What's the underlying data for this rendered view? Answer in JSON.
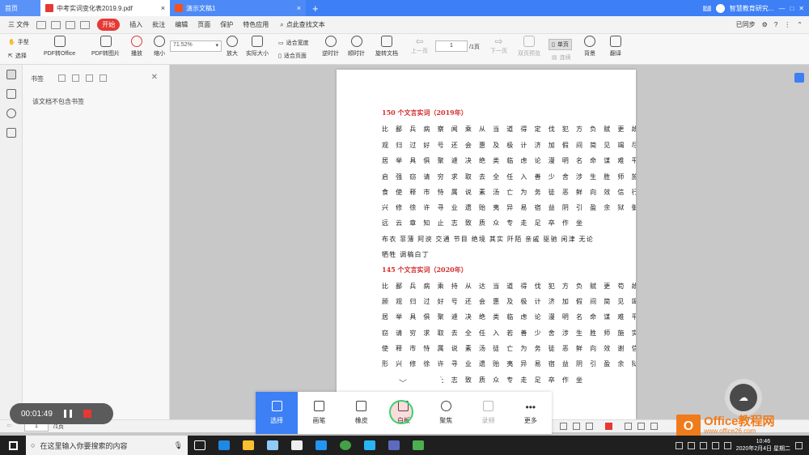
{
  "tabs": {
    "home": "首页",
    "active": "中考实词变化表2019.9.pdf",
    "other": "演示文稿1",
    "badge": "2",
    "account": "智慧教育研究..."
  },
  "menu": {
    "file": "三 文件",
    "items": [
      "开始",
      "插入",
      "批注",
      "编辑",
      "页面",
      "保护",
      "特色应用"
    ],
    "search": "点此查找文本",
    "sync": "已同步",
    "more": "?"
  },
  "ribbon": {
    "hand": "手型",
    "select": "选择",
    "pdf_to_office": "PDF转Office",
    "pdf_to_image": "PDF转图片",
    "play": "播放",
    "zoom_out": "缩小",
    "zoom_value": "71.52%",
    "zoom_in": "放大",
    "actual_size": "实际大小",
    "fit_width": "适合宽度",
    "fit_page": "适合页面",
    "rotate_ccw": "逆时针",
    "rotate_cw": "顺时针",
    "rotate_doc": "旋转文档",
    "prev": "上一页",
    "page_value": "1",
    "page_total": "/1页",
    "next": "下一页",
    "double": "双页预览",
    "single": "单页",
    "continuous": "连续",
    "background": "背景",
    "translate": "翻译"
  },
  "bookmark": {
    "title": "书签",
    "empty": "该文档不包含书签"
  },
  "document": {
    "heading1": "150 个文言实词（2019年）",
    "lines1": [
      "比 鄙 兵 病 察 闻 乘 从 当 道 得 定 伐 犯 方 负 赋 更 故 顾",
      "观 归 过 好 号 还 会 惠 及 极 计 济 加 假 间 简 见 竭 尽 进",
      "居 举 具 俱 聚 遽 决 绝 类 临 虑 论 漫 明 名 命 谋 难 平 戚",
      "启 强 窃 请 穷 求 取 去 全 任 入 善 少 舍 涉 生 胜 师 施 实",
      "食 使 释 市 恃 属 说 素 汤 亡 为 务 徒 恶 鲜 向 效 信 行 形",
      "兴 修 徐 许 寻 业 遗 贻 夷 异 易 宿 益 阴 引 盈 余 狱 御 缘",
      "远 云 章 知 止 志 致 质 众 专 走 足 卒 作 坐"
    ],
    "words1": [
      "布衣  菲薄  阿谀  交通  节目  绝境  其实  阡陌  亲戚  驱驰  闲津  无论",
      "牺牲  调稿白丁"
    ],
    "heading2": "145 个文言实词（2020年）",
    "lines2": [
      "比 鄙 兵 病 乘 持 从 达 当 道 得 伐 犯 方 负 赋 更 苟 故",
      "顾 观 归 过 好 号 还 会 惠 及 极 计 济 加 假 间 简 见 竭 进",
      "居 举 具 俱 聚 遽 决 绝 类 临 虑 论 漫 明 名 命 谋 难 平 戚 强",
      "窃 请 穷 求 取 去 全 任 入 若 善 少 舍 涉 生 胜 师 施 实 食",
      "使 释 市 恃 属 说 素 汤 徒 亡 为 务 徒 恶 鲜 向 效 谢 信 行",
      "形 兴 修 徐 许 寻 业 遗 贻 夷 异 易 宿 益 阴 引 盈 余 狱 御",
      "远 云 章 知 止 志 致 质 众 专 走 足 卒 作 坐"
    ]
  },
  "footer": {
    "page": "1",
    "total": "/1页"
  },
  "recorder": {
    "time": "00:01:49"
  },
  "pen_toolbar": {
    "items": [
      "选择",
      "画笔",
      "橡皮",
      "白板",
      "聚焦",
      "录频",
      "更多"
    ]
  },
  "logo": {
    "letter": "O",
    "name": "Office教程网",
    "url": "www.office26.com"
  },
  "taskbar": {
    "search": "在这里输入你要搜索的内容",
    "time": "10:46",
    "date": "2020年2月4日 星期二"
  }
}
